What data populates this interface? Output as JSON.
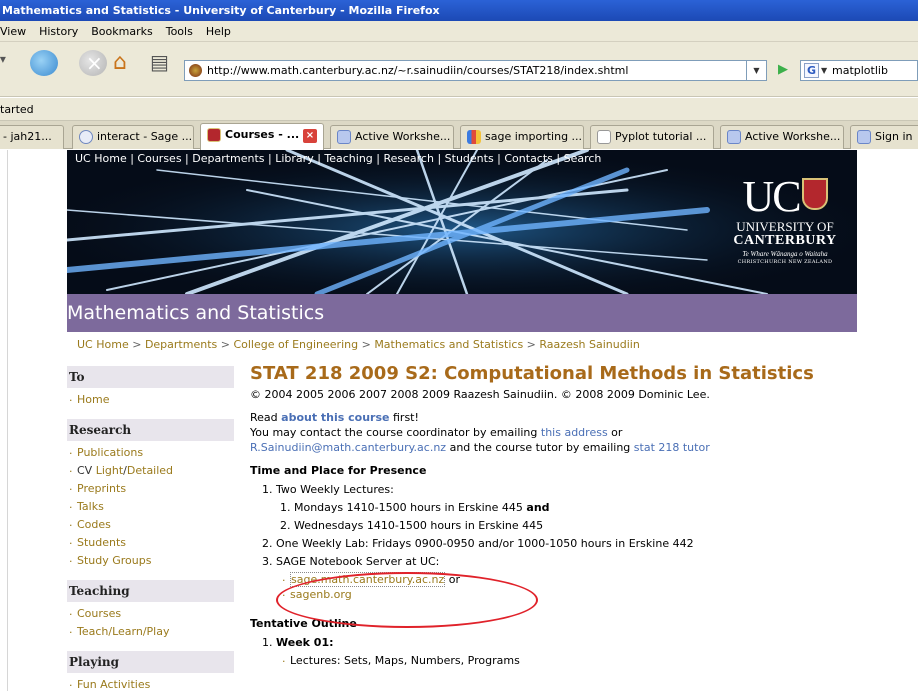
{
  "window": {
    "title": "Mathematics and Statistics - University of Canterbury - Mozilla Firefox"
  },
  "menu": [
    "View",
    "History",
    "Bookmarks",
    "Tools",
    "Help"
  ],
  "address": {
    "url": "http://www.math.canterbury.ac.nz/~r.sainudiin/courses/STAT218/index.shtml"
  },
  "search": {
    "value": "matplotlib"
  },
  "bookmarks_bar": {
    "text": "tarted"
  },
  "tabs": [
    {
      "label": "- jah21...",
      "active": false,
      "icon": "page-icon"
    },
    {
      "label": "interact - Sage ...",
      "active": false,
      "icon": "sage-icon"
    },
    {
      "label": "Courses - ...",
      "active": true,
      "icon": "uc-crest-icon"
    },
    {
      "label": "Active Workshe...",
      "active": false,
      "icon": "sage-worksheet-icon"
    },
    {
      "label": "sage importing ...",
      "active": false,
      "icon": "google-icon"
    },
    {
      "label": "Pyplot tutorial ...",
      "active": false,
      "icon": "document-icon"
    },
    {
      "label": "Active Workshe...",
      "active": false,
      "icon": "sage-worksheet-icon"
    },
    {
      "label": "Sign in",
      "active": false,
      "icon": "sage-worksheet-icon"
    }
  ],
  "banner": {
    "links": "UC Home | Courses | Departments | Library | Teaching | Research | Students | Contacts | Search",
    "logo_letters": "UC",
    "logo_univ": "UNIVERSITY OF",
    "logo_cant": "CANTERBURY",
    "logo_tag1": "Te Whare Wānanga o Waitaha",
    "logo_tag2": "CHRISTCHURCH NEW ZEALAND"
  },
  "dept": {
    "title": "Mathematics and Statistics"
  },
  "breadcrumb": {
    "uc_home": "UC Home",
    "sep": " > ",
    "departments": "Departments",
    "engineering": "College of Engineering",
    "maths": "Mathematics and Statistics",
    "person": "Raazesh Sainudiin"
  },
  "sidebar": {
    "to": {
      "heading": "To",
      "items": [
        "Home"
      ]
    },
    "research": {
      "heading": "Research",
      "publications": "Publications",
      "cv": "CV",
      "light": "Light",
      "slash": "/",
      "detailed": "Detailed",
      "preprints": "Preprints",
      "talks": "Talks",
      "codes": "Codes",
      "students": "Students",
      "study_groups": "Study Groups"
    },
    "teaching": {
      "heading": "Teaching",
      "courses": "Courses",
      "tlp": "Teach/Learn/Play"
    },
    "playing": {
      "heading": "Playing",
      "fun": "Fun Activities"
    }
  },
  "main": {
    "title": "STAT 218 2009 S2: Computational Methods in Statistics",
    "copyright": "© 2004 2005 2006 2007 2008 2009 Raazesh Sainudiin. © 2008 2009 Dominic Lee.",
    "read": "Read ",
    "about_link": "about this course",
    "first": " first!",
    "contact1": "You may contact the course coordinator by emailing ",
    "this_address": "this address",
    "or": " or",
    "email_link": "R.Sainudiin@math.canterbury.ac.nz",
    "contact2": " and the course tutor by emailing ",
    "tutor_link": "stat 218 tutor",
    "time_heading": "Time and Place for Presence",
    "item1": "1. Two Weekly Lectures:",
    "item1a_pre": "1. Mondays 1410-1500 hours in Erskine 445 ",
    "item1a_and": "and",
    "item1b": "2. Wednesdays 1410-1500 hours in Erskine 445",
    "item2": "2. One Weekly Lab: Fridays 0900-0950 and/or 1000-1050 hours in Erskine 442",
    "item3": "3. SAGE Notebook Server at UC:",
    "sage_link": "sage.math.canterbury.ac.nz",
    "or2": " or",
    "sagenb_link": "sagenb.org",
    "outline_heading": "Tentative Outline",
    "week_num": "1. ",
    "week1": "Week 01:",
    "lectures": "Lectures: Sets, Maps, Numbers, Programs"
  }
}
